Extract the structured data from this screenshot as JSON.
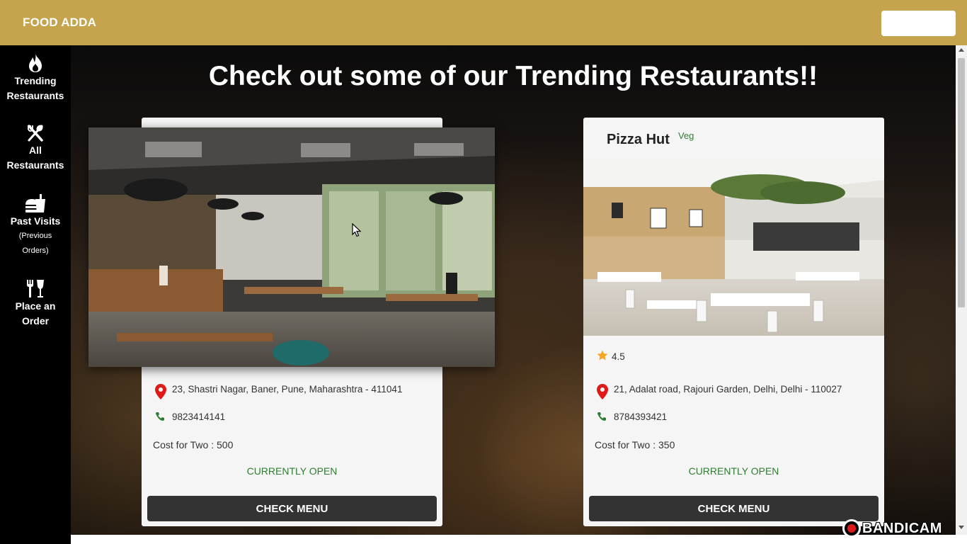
{
  "app": {
    "brand": "FOOD ADDA"
  },
  "sidebar": {
    "items": [
      {
        "icon": "flame-icon",
        "label_line1": "Trending",
        "label_line2": "Restaurants"
      },
      {
        "icon": "utensils-icon",
        "label_line1": "All",
        "label_line2": "Restaurants"
      },
      {
        "icon": "fastfood-icon",
        "label_line1": "Past Visits",
        "sub_line1": "(Previous",
        "sub_line2": "Orders)"
      },
      {
        "icon": "dining-icon",
        "label_line1": "Place an",
        "label_line2": "Order"
      }
    ]
  },
  "main": {
    "title": "Check out some of our Trending Restaurants!!",
    "cards": [
      {
        "name": "",
        "tag": "",
        "image": "cafe-interior-photo",
        "address": "23, Shastri Nagar, Baner, Pune, Maharashtra - 411041",
        "phone": "9823414141",
        "cost": "Cost for Two : 500",
        "status": "CURRENTLY OPEN",
        "button": "CHECK MENU"
      },
      {
        "name": "Pizza Hut",
        "tag": "Veg",
        "image": "restaurant-interior-photo",
        "rating": "4.5",
        "address": "21, Adalat road, Rajouri Garden, Delhi, Delhi - 110027",
        "phone": "8784393421",
        "cost": "Cost for Two : 350",
        "status": "CURRENTLY OPEN",
        "button": "CHECK MENU"
      }
    ]
  },
  "watermark": {
    "text": "BANDICAM"
  },
  "colors": {
    "appbar": "#c6a34d",
    "sidebar": "#000000",
    "open_status": "#2e7d32",
    "button": "#333333",
    "pin": "#e01919",
    "star": "#f5a623"
  }
}
